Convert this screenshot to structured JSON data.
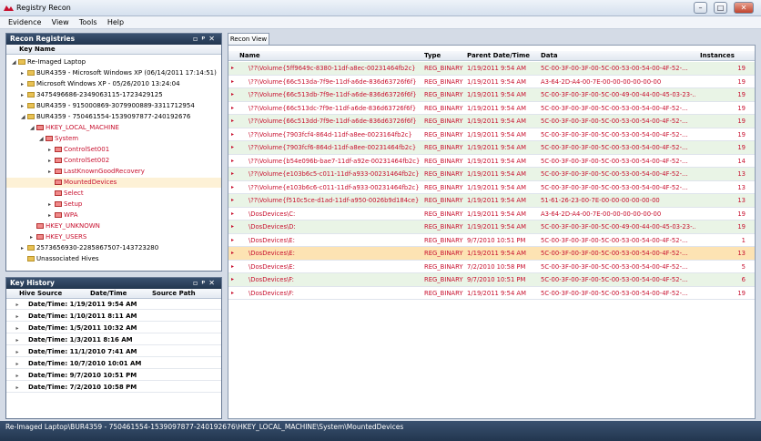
{
  "window": {
    "title": "Registry Recon"
  },
  "menu": [
    "Evidence",
    "View",
    "Tools",
    "Help"
  ],
  "recon_registries": {
    "title": "Recon Registries",
    "column": "Key Name",
    "nodes": [
      {
        "label": "Re-Imaged Laptop",
        "level": 0,
        "expander": "◢",
        "red": false
      },
      {
        "label": "BUR4359 - Microsoft Windows XP (06/14/2011 17:14:51)",
        "level": 1,
        "expander": "▸",
        "red": false
      },
      {
        "label": "Microsoft Windows XP - 05/26/2010 13:24:04",
        "level": 1,
        "expander": "▸",
        "red": false
      },
      {
        "label": "3475496686-2349063115-1723429125",
        "level": 1,
        "expander": "▸",
        "red": false
      },
      {
        "label": "BUR4359 - 915000869-3079900889-3311712954",
        "level": 1,
        "expander": "▸",
        "red": false
      },
      {
        "label": "BUR4359 - 750461554-1539097877-240192676",
        "level": 1,
        "expander": "◢",
        "red": false
      },
      {
        "label": "HKEY_LOCAL_MACHINE",
        "level": 2,
        "expander": "◢",
        "red": true
      },
      {
        "label": "System",
        "level": 3,
        "expander": "◢",
        "red": true
      },
      {
        "label": "ControlSet001",
        "level": 4,
        "expander": "▸",
        "red": true
      },
      {
        "label": "ControlSet002",
        "level": 4,
        "expander": "▸",
        "red": true
      },
      {
        "label": "LastKnownGoodRecovery",
        "level": 4,
        "expander": "▸",
        "red": true
      },
      {
        "label": "MountedDevices",
        "level": 4,
        "expander": "",
        "red": true,
        "selected": true
      },
      {
        "label": "Select",
        "level": 4,
        "expander": "",
        "red": true
      },
      {
        "label": "Setup",
        "level": 4,
        "expander": "▸",
        "red": true
      },
      {
        "label": "WPA",
        "level": 4,
        "expander": "▸",
        "red": true
      },
      {
        "label": "HKEY_UNKNOWN",
        "level": 2,
        "expander": "",
        "red": true
      },
      {
        "label": "HKEY_USERS",
        "level": 2,
        "expander": "▸",
        "red": true
      },
      {
        "label": "2573656930-2285867507-143723280",
        "level": 1,
        "expander": "▸",
        "red": false
      },
      {
        "label": "Unassociated Hives",
        "level": 1,
        "expander": "",
        "red": false
      }
    ]
  },
  "key_history": {
    "title": "Key History",
    "columns": [
      "Hive Source",
      "Date/Time",
      "Source Path"
    ],
    "rows": [
      "Date/Time: 1/19/2011 9:54 AM",
      "Date/Time: 1/10/2011 8:11 AM",
      "Date/Time: 1/5/2011 10:32 AM",
      "Date/Time: 1/3/2011 8:16 AM",
      "Date/Time: 11/1/2010 7:41 AM",
      "Date/Time: 10/7/2010 10:01 AM",
      "Date/Time: 9/7/2010 10:51 PM",
      "Date/Time: 7/2/2010 10:58 PM"
    ]
  },
  "recon_view": {
    "tab": "Recon View",
    "columns": [
      "Name",
      "Type",
      "Parent Date/Time",
      "Data",
      "Instances"
    ],
    "rows": [
      {
        "name": "\\??\\Volume{5ff9649c-8380-11df-a8ec-00231464fb2c}",
        "type": "REG_BINARY",
        "date": "1/19/2011 9:54 AM",
        "data": "5C-00-3F-00-3F-00-5C-00-53-00-54-00-4F-52-...",
        "instances": "19"
      },
      {
        "name": "\\??\\Volume{66c513da-7f9e-11df-a6de-836d63726f6f}",
        "type": "REG_BINARY",
        "date": "1/19/2011 9:54 AM",
        "data": "A3-64-2D-A4-00-7E-00-00-00-00-00-00",
        "instances": "19"
      },
      {
        "name": "\\??\\Volume{66c513db-7f9e-11df-a6de-836d63726f6f}",
        "type": "REG_BINARY",
        "date": "1/19/2011 9:54 AM",
        "data": "5C-00-3F-00-3F-00-5C-00-49-00-44-00-45-03-23-...",
        "instances": "19"
      },
      {
        "name": "\\??\\Volume{66c513dc-7f9e-11df-a6de-836d63726f6f}",
        "type": "REG_BINARY",
        "date": "1/19/2011 9:54 AM",
        "data": "5C-00-3F-00-3F-00-5C-00-53-00-54-00-4F-52-...",
        "instances": "19"
      },
      {
        "name": "\\??\\Volume{66c513dd-7f9e-11df-a6de-836d63726f6f}",
        "type": "REG_BINARY",
        "date": "1/19/2011 9:54 AM",
        "data": "5C-00-3F-00-3F-00-5C-00-53-00-54-00-4F-52-...",
        "instances": "19"
      },
      {
        "name": "\\??\\Volume{7903fcf4-864d-11df-a8ee-0023164fb2c}",
        "type": "REG_BINARY",
        "date": "1/19/2011 9:54 AM",
        "data": "5C-00-3F-00-3F-00-5C-00-53-00-54-00-4F-52-...",
        "instances": "19"
      },
      {
        "name": "\\??\\Volume{7903fcf6-864d-11df-a8ee-00231464fb2c}",
        "type": "REG_BINARY",
        "date": "1/19/2011 9:54 AM",
        "data": "5C-00-3F-00-3F-00-5C-00-53-00-54-00-4F-52-...",
        "instances": "19"
      },
      {
        "name": "\\??\\Volume{b54e096b-bae7-11df-a92e-00231464fb2c}",
        "type": "REG_BINARY",
        "date": "1/19/2011 9:54 AM",
        "data": "5C-00-3F-00-3F-00-5C-00-53-00-54-00-4F-52-...",
        "instances": "14"
      },
      {
        "name": "\\??\\Volume{e103b6c5-c011-11df-a933-00231464fb2c}",
        "type": "REG_BINARY",
        "date": "1/19/2011 9:54 AM",
        "data": "5C-00-3F-00-3F-00-5C-00-53-00-54-00-4F-52-...",
        "instances": "13"
      },
      {
        "name": "\\??\\Volume{e103b6c6-c011-11df-a933-00231464fb2c}",
        "type": "REG_BINARY",
        "date": "1/19/2011 9:54 AM",
        "data": "5C-00-3F-00-3F-00-5C-00-53-00-54-00-4F-52-...",
        "instances": "13"
      },
      {
        "name": "\\??\\Volume{f510c5ce-d1ad-11df-a950-0026b9d184ce}",
        "type": "REG_BINARY",
        "date": "1/19/2011 9:54 AM",
        "data": "51-61-26-23-00-7E-00-00-00-00-00-00",
        "instances": "13"
      },
      {
        "name": "\\DosDevices\\C:",
        "type": "REG_BINARY",
        "date": "1/19/2011 9:54 AM",
        "data": "A3-64-2D-A4-00-7E-00-00-00-00-00-00",
        "instances": "19"
      },
      {
        "name": "\\DosDevices\\D:",
        "type": "REG_BINARY",
        "date": "1/19/2011 9:54 AM",
        "data": "5C-00-3F-00-3F-00-5C-00-49-00-44-00-45-03-23-...",
        "instances": "19"
      },
      {
        "name": "\\DosDevices\\E:",
        "type": "REG_BINARY",
        "date": "9/7/2010 10:51 PM",
        "data": "5C-00-3F-00-3F-00-5C-00-53-00-54-00-4F-52-...",
        "instances": "1"
      },
      {
        "name": "\\DosDevices\\E:",
        "type": "REG_BINARY",
        "date": "1/19/2011 9:54 AM",
        "data": "5C-00-3F-00-3F-00-5C-00-53-00-54-00-4F-52-...",
        "instances": "13",
        "highlight": true
      },
      {
        "name": "\\DosDevices\\E:",
        "type": "REG_BINARY",
        "date": "7/2/2010 10:58 PM",
        "data": "5C-00-3F-00-3F-00-5C-00-53-00-54-00-4F-52-...",
        "instances": "5"
      },
      {
        "name": "\\DosDevices\\F:",
        "type": "REG_BINARY",
        "date": "9/7/2010 10:51 PM",
        "data": "5C-00-3F-00-3F-00-5C-00-53-00-54-00-4F-52-...",
        "instances": "6"
      },
      {
        "name": "\\DosDevices\\F:",
        "type": "REG_BINARY",
        "date": "1/19/2011 9:54 AM",
        "data": "5C-00-3F-00-3F-00-5C-00-53-00-54-00-4F-52-...",
        "instances": "19"
      }
    ]
  },
  "status": "Re-Imaged Laptop\\BUR4359 - 750461554-1539097877-240192676\\HKEY_LOCAL_MACHINE\\System\\MountedDevices",
  "colors": {
    "header": "#22364f",
    "accent_red": "#c8102e",
    "row_alt": "#e9f4e6",
    "row_highlight": "#fde3b3"
  }
}
